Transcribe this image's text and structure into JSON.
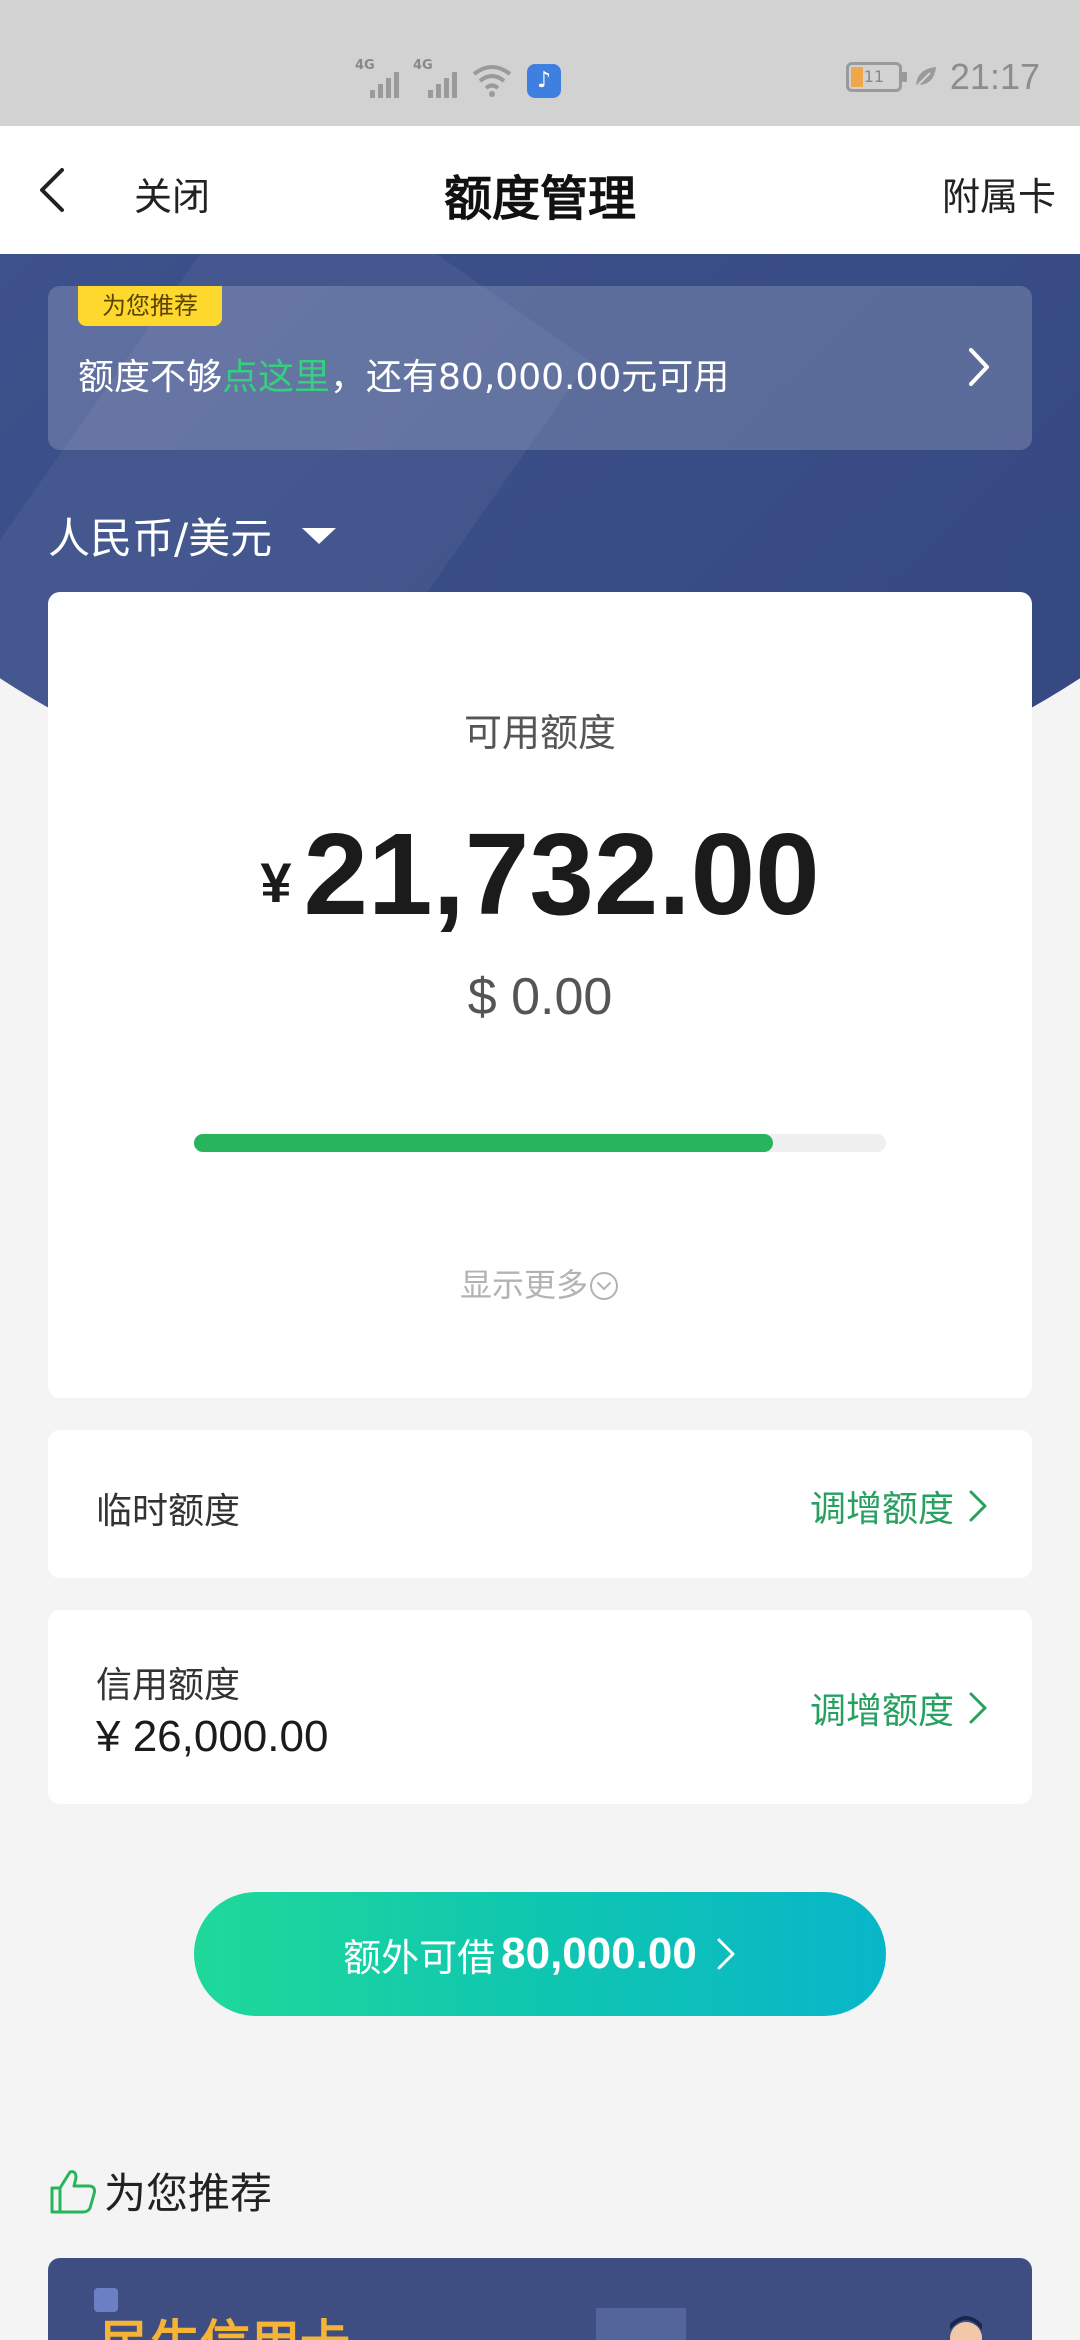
{
  "status_bar": {
    "network_1": "4G",
    "network_2": "4G",
    "battery_level": "11",
    "time": "21:17",
    "icons": [
      "signal-icon",
      "signal-icon",
      "wifi-icon",
      "music-app-icon",
      "battery-icon",
      "leaf-icon"
    ]
  },
  "nav": {
    "close_label": "关闭",
    "title": "额度管理",
    "right_label": "附属卡"
  },
  "promo": {
    "tag": "为您推荐",
    "text_before": "额度不够",
    "text_highlight": "点这里",
    "text_after": "，还有80,000.00元可用"
  },
  "currency": {
    "label": "人民币/美元"
  },
  "available": {
    "label": "可用额度",
    "currency_symbol": "¥",
    "amount": "21,732.00",
    "usd_amount": "$ 0.00",
    "usage_fraction": 0.836,
    "more_label": "显示更多"
  },
  "temp_limit": {
    "title": "临时额度",
    "action": "调增额度"
  },
  "credit_limit": {
    "title": "信用额度",
    "value": "¥ 26,000.00",
    "action": "调增额度"
  },
  "cta": {
    "prefix": "额外可借",
    "amount": "80,000.00"
  },
  "recommend": {
    "title": "为您推荐",
    "banner_title": "民生信用卡"
  },
  "colors": {
    "accent_green": "#27b45d",
    "hero_blue": "#3b4f8a",
    "promo_yellow": "#ffd82e",
    "cta_start": "#1fd99a",
    "cta_end": "#08b6c9"
  }
}
